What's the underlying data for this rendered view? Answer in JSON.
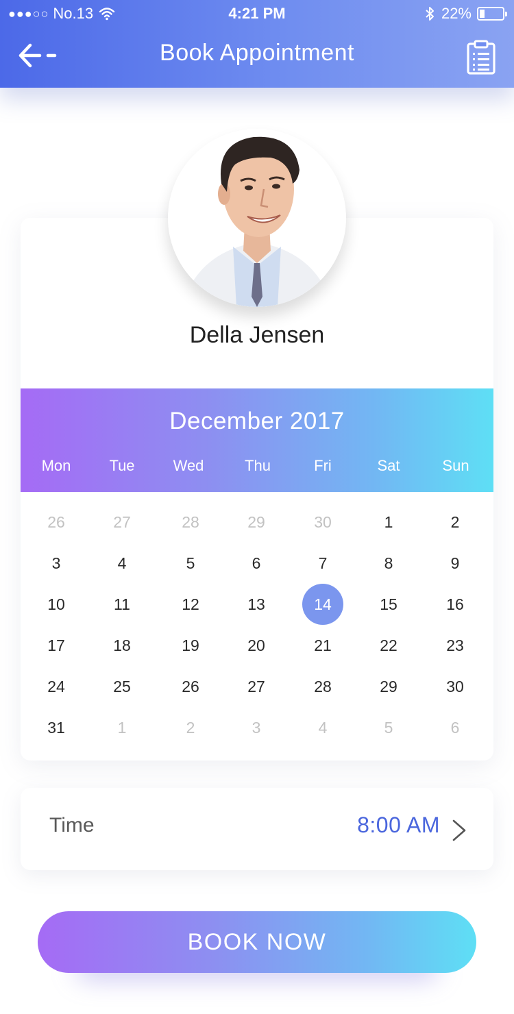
{
  "status_bar": {
    "signal": "●●●○○",
    "carrier": "No.13",
    "time": "4:21 PM",
    "battery_percent": "22%",
    "icons": [
      "wifi-icon",
      "bluetooth-icon",
      "battery-icon"
    ]
  },
  "header": {
    "title": "Book Appointment",
    "back_icon": "arrow-left-icon",
    "action_icon": "clipboard-list-icon"
  },
  "doctor": {
    "name": "Della Jensen",
    "avatar_icon": "doctor-avatar"
  },
  "calendar": {
    "month_title": "December 2017",
    "weekdays": [
      "Mon",
      "Tue",
      "Wed",
      "Thu",
      "Fri",
      "Sat",
      "Sun"
    ],
    "weeks": [
      [
        "26",
        "27",
        "28",
        "29",
        "30",
        "1",
        "2"
      ],
      [
        "3",
        "4",
        "5",
        "6",
        "7",
        "8",
        "9"
      ],
      [
        "10",
        "11",
        "12",
        "13",
        "14",
        "15",
        "16"
      ],
      [
        "17",
        "18",
        "19",
        "20",
        "21",
        "22",
        "23"
      ],
      [
        "24",
        "25",
        "26",
        "27",
        "28",
        "29",
        "30"
      ],
      [
        "31",
        "1",
        "2",
        "3",
        "4",
        "5",
        "6"
      ]
    ],
    "muted": [
      [
        true,
        true,
        true,
        true,
        true,
        false,
        false
      ],
      [
        false,
        false,
        false,
        false,
        false,
        false,
        false
      ],
      [
        false,
        false,
        false,
        false,
        false,
        false,
        false
      ],
      [
        false,
        false,
        false,
        false,
        false,
        false,
        false
      ],
      [
        false,
        false,
        false,
        false,
        false,
        false,
        false
      ],
      [
        false,
        true,
        true,
        true,
        true,
        true,
        true
      ]
    ],
    "selected_day": "14"
  },
  "time": {
    "label": "Time",
    "value": "8:00 AM",
    "chevron_icon": "chevron-right-icon"
  },
  "book_button": {
    "label": "BOOK NOW"
  },
  "colors": {
    "header_gradient_start": "#4c69e8",
    "header_gradient_end": "#8aa3f2",
    "accent_gradient_start": "#a56bf5",
    "accent_gradient_end": "#5edff5",
    "selected_day": "#7b96ee",
    "time_value": "#4a66dd"
  }
}
